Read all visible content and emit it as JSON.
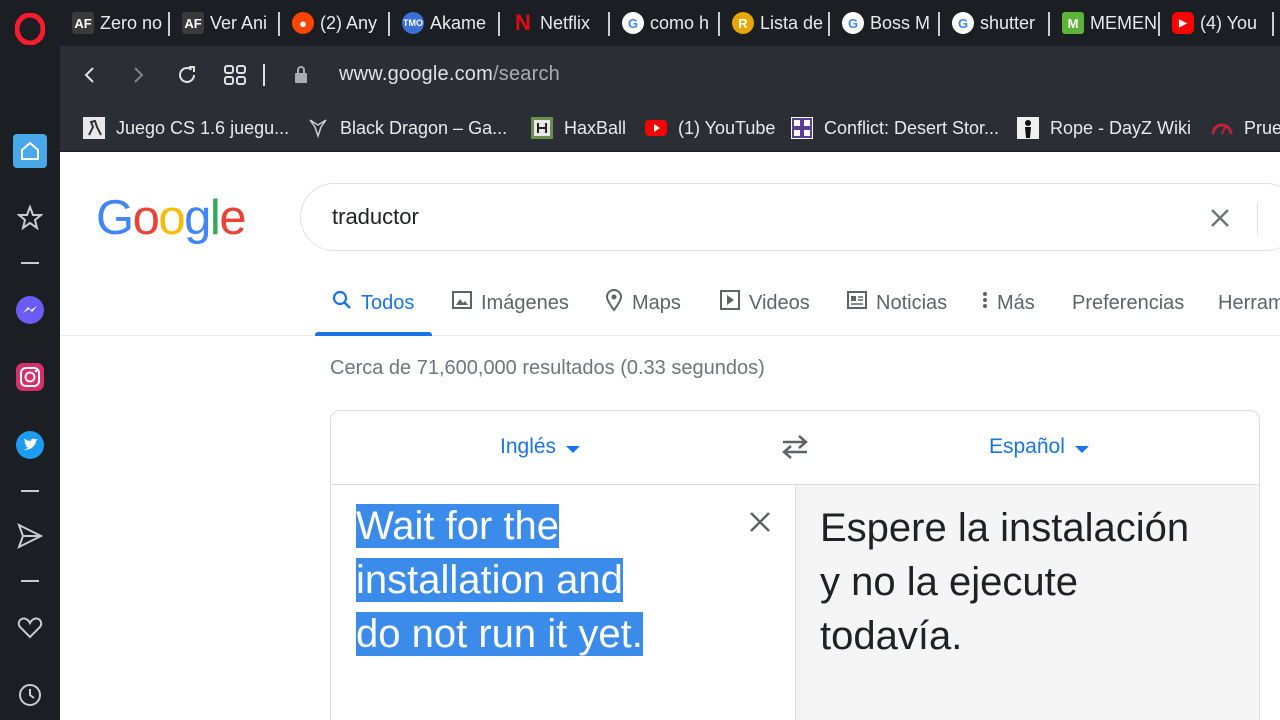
{
  "browser": {
    "tabs": [
      {
        "label": "Zero no",
        "icon": "animeflv-icon"
      },
      {
        "label": "Ver Ani",
        "icon": "animeflv-icon"
      },
      {
        "label": "(2) Any",
        "icon": "reddit-icon"
      },
      {
        "label": "Akame",
        "icon": "tmo-icon"
      },
      {
        "label": "Netflix",
        "icon": "netflix-icon"
      },
      {
        "label": "como h",
        "icon": "google-icon"
      },
      {
        "label": "Lista de",
        "icon": "r-site-icon"
      },
      {
        "label": "Boss M",
        "icon": "google-icon"
      },
      {
        "label": "shutter",
        "icon": "google-icon"
      },
      {
        "label": "MEMEN",
        "icon": "meme-icon"
      },
      {
        "label": "(4) You",
        "icon": "youtube-icon"
      }
    ],
    "address": {
      "domain": "www.google.com",
      "path": "/search"
    },
    "bookmarks": [
      {
        "label": "Juego CS 1.6 juegu...",
        "icon": "cs-icon"
      },
      {
        "label": "Black Dragon – Ga...",
        "icon": "dragon-icon"
      },
      {
        "label": "HaxBall",
        "icon": "haxball-icon"
      },
      {
        "label": "(1) YouTube",
        "icon": "youtube-icon"
      },
      {
        "label": "Conflict: Desert Stor...",
        "icon": "game-icon"
      },
      {
        "label": "Rope - DayZ Wiki",
        "icon": "dayz-icon"
      },
      {
        "label": "Prue",
        "icon": "gauge-icon"
      }
    ],
    "sidebar": [
      "home-icon",
      "star-icon",
      "messenger-icon",
      "instagram-icon",
      "twitter-icon",
      "send-icon",
      "heart-icon",
      "history-icon"
    ]
  },
  "google": {
    "logo": [
      "G",
      "o",
      "o",
      "g",
      "l",
      "e"
    ],
    "logo_colors": [
      "#4285f4",
      "#ea4335",
      "#fbbc05",
      "#4285f4",
      "#34a853",
      "#ea4335"
    ],
    "query": "traductor",
    "tabs": {
      "all": "Todos",
      "images": "Imágenes",
      "maps": "Maps",
      "videos": "Videos",
      "news": "Noticias",
      "more": "Más",
      "prefs": "Preferencias",
      "tools": "Herram"
    },
    "stats": "Cerca de 71,600,000 resultados (0.33 segundos)",
    "translator": {
      "source_lang": "Inglés",
      "target_lang": "Español",
      "source_lines": [
        "Wait for the",
        "installation and",
        "do not run it yet."
      ],
      "target_lines": [
        "Espere la instalación",
        "y no la ejecute",
        "todavía."
      ]
    }
  }
}
